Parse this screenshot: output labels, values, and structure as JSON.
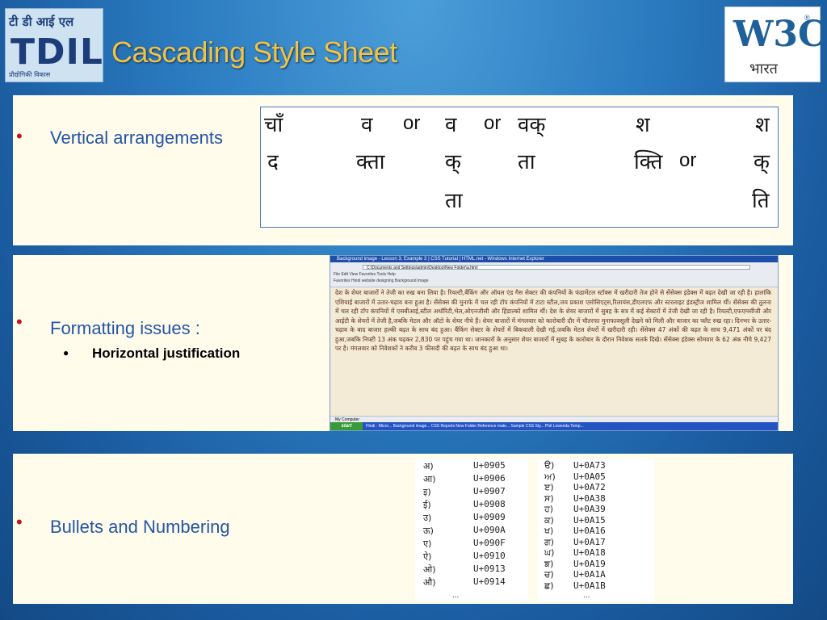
{
  "header": {
    "title": "Cascading Style Sheet",
    "tdil_logo": {
      "devanagari": "टी डी आई एल",
      "text": "TDIL",
      "small": "प्रौद्योगिकी विकास"
    },
    "w3c_logo": {
      "text": "W3C",
      "registered": "®",
      "subtitle": "भारत"
    }
  },
  "slide": {
    "item1": {
      "label": "Vertical arrangements"
    },
    "item2": {
      "label": "Formatting issues :",
      "sub": "Horizontal justification"
    },
    "item3": {
      "label": "Bullets and Numbering"
    }
  },
  "vertical_table": {
    "or": "or",
    "col1": [
      "चाँ",
      "द"
    ],
    "col2": [
      "व",
      "क्ता"
    ],
    "col3": [
      "व",
      "क्",
      "ता"
    ],
    "col4": [
      "वक्",
      "ता"
    ],
    "col5": [
      "श",
      "क्ति"
    ],
    "col6": [
      "श",
      "क्",
      "ति"
    ]
  },
  "screenshot": {
    "window_title": "Background image - Lesson 3, Example 3 | CSS Tutorial | HTML.net - Windows Internet Explorer",
    "address": "C:\\Documents and Settings\\admin\\Desktop\\New Folder\\a.html",
    "menu": "File   Edit   View   Favorites   Tools   Help",
    "favorites": "Favorites   Hindi website designing   Background image",
    "body_text": "देश के शेयर बाजारों ने तेजी का रुख बना लिया है। रियल्टी,बैंकिंग और ऑयल एंड गैस सेक्टर की कंपनियों के फंडामेंटल स्टॉक्स में खरीदारी तेज होने से सेंसेक्स इंडेक्स में बढ़त देखी जा रही है। हालांकि एशियाई बाजारों में उतार-चढ़ाव बना हुआ है। सेंसेक्स की मुनाफे में चल रही टॉप कंपनियों में टाटा स्टील,जय प्रकाश एसोसिएट्स,रिलायंस,डीएलएफ और स्टरलाइट इंडस्ट्रीज शामिल थीं। सेंसेक्स की तुलना में चल रही टॉप कंपनियों में एसबीआई,स्टील अथॉरिटी,भेल,ओएनजीसी और हिंडाल्को शामिल थीं। देश के शेयर बाजारों में सुबह के सत्र में कई सेक्टरों में तेजी देखी जा रही है। रियल्टी,एफएमसीजी और आईटी के शेयरों में तेजी है,जबकि मेटल और ऑटो के शेयर नीचे हैं। शेयर बाजारों में मंगलवार को कारोबारी दौर में चौतरफा मुनाफावसूली देखने को मिली और बाजार का फ्लैट रुख रहा। दिनभर के उतार-चढ़ाव के बाद बाजार हल्की बढ़त के साथ बंद हुआ। बैंकिंग सेक्टर के शेयरों में बिकवाली देखी गई,जबकि मेटल शेयरों में खरीदारी रही। सेंसेक्स 47 अंकों की बढ़त के साथ 9,471 अंकों पर बंद हुआ,जबकि निफ्टी 13 अंक चढ़कर 2,830 पर पहुंच गया था। जानकारों के अनुसार शेयर बाजारों में सुबह के कारोबार के दौरान निवेशक सतर्क दिखे। सेंसेक्स इंडेक्स सोमवार के 62 अंक नीचे 9,427 पर है। मंगलवार को निवेशकों ने करीब 3 फीसदी की बढ़त के साथ बंद हुआ था।",
    "status": "My Computer",
    "start": "start",
    "taskbar": "Hindi - Micro...   Background image...   CSS Reports   New Folder   Reference mate...   Sample CSS Sty...   Phil Lowenda Temp..."
  },
  "codes_left": [
    {
      "char": "अ)",
      "code": "U+0905"
    },
    {
      "char": "आ)",
      "code": "U+0906"
    },
    {
      "char": "इ)",
      "code": "U+0907"
    },
    {
      "char": "ई)",
      "code": "U+0908"
    },
    {
      "char": "उ)",
      "code": "U+0909"
    },
    {
      "char": "ऊ)",
      "code": "U+090A"
    },
    {
      "char": "ए)",
      "code": "U+090F"
    },
    {
      "char": "ऐ)",
      "code": "U+0910"
    },
    {
      "char": "ओ)",
      "code": "U+0913"
    },
    {
      "char": "औ)",
      "code": "U+0914"
    }
  ],
  "codes_right": [
    {
      "char": "ੳ)",
      "code": "U+0A73"
    },
    {
      "char": "ਅ)",
      "code": "U+0A05"
    },
    {
      "char": "ੲ)",
      "code": "U+0A72"
    },
    {
      "char": "ਸ)",
      "code": "U+0A38"
    },
    {
      "char": "ਹ)",
      "code": "U+0A39"
    },
    {
      "char": "ਕ)",
      "code": "U+0A15"
    },
    {
      "char": "ਖ)",
      "code": "U+0A16"
    },
    {
      "char": "ਗ)",
      "code": "U+0A17"
    },
    {
      "char": "ਘ)",
      "code": "U+0A18"
    },
    {
      "char": "ਙ)",
      "code": "U+0A19"
    },
    {
      "char": "ਚ)",
      "code": "U+0A1A"
    },
    {
      "char": "ਛ)",
      "code": "U+0A1B"
    }
  ],
  "continuation": "..."
}
